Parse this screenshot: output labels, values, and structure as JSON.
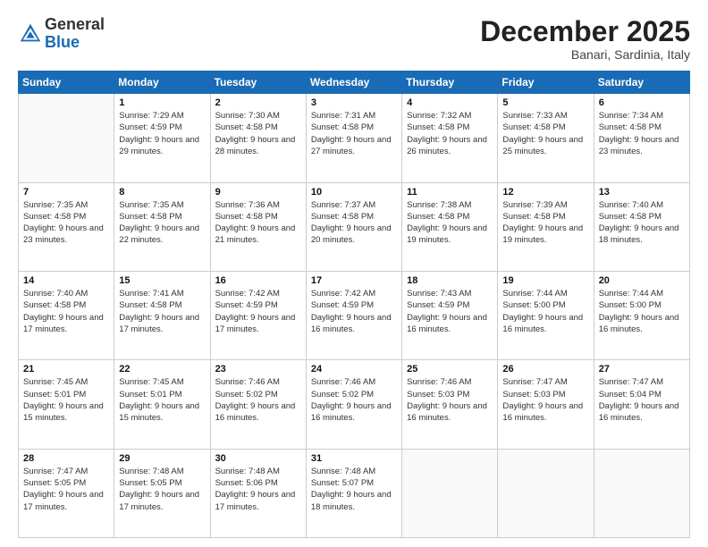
{
  "logo": {
    "general": "General",
    "blue": "Blue"
  },
  "header": {
    "month": "December 2025",
    "location": "Banari, Sardinia, Italy"
  },
  "days_of_week": [
    "Sunday",
    "Monday",
    "Tuesday",
    "Wednesday",
    "Thursday",
    "Friday",
    "Saturday"
  ],
  "weeks": [
    [
      {
        "num": "",
        "sunrise": "",
        "sunset": "",
        "daylight": ""
      },
      {
        "num": "1",
        "sunrise": "Sunrise: 7:29 AM",
        "sunset": "Sunset: 4:59 PM",
        "daylight": "Daylight: 9 hours and 29 minutes."
      },
      {
        "num": "2",
        "sunrise": "Sunrise: 7:30 AM",
        "sunset": "Sunset: 4:58 PM",
        "daylight": "Daylight: 9 hours and 28 minutes."
      },
      {
        "num": "3",
        "sunrise": "Sunrise: 7:31 AM",
        "sunset": "Sunset: 4:58 PM",
        "daylight": "Daylight: 9 hours and 27 minutes."
      },
      {
        "num": "4",
        "sunrise": "Sunrise: 7:32 AM",
        "sunset": "Sunset: 4:58 PM",
        "daylight": "Daylight: 9 hours and 26 minutes."
      },
      {
        "num": "5",
        "sunrise": "Sunrise: 7:33 AM",
        "sunset": "Sunset: 4:58 PM",
        "daylight": "Daylight: 9 hours and 25 minutes."
      },
      {
        "num": "6",
        "sunrise": "Sunrise: 7:34 AM",
        "sunset": "Sunset: 4:58 PM",
        "daylight": "Daylight: 9 hours and 23 minutes."
      }
    ],
    [
      {
        "num": "7",
        "sunrise": "Sunrise: 7:35 AM",
        "sunset": "Sunset: 4:58 PM",
        "daylight": "Daylight: 9 hours and 23 minutes."
      },
      {
        "num": "8",
        "sunrise": "Sunrise: 7:35 AM",
        "sunset": "Sunset: 4:58 PM",
        "daylight": "Daylight: 9 hours and 22 minutes."
      },
      {
        "num": "9",
        "sunrise": "Sunrise: 7:36 AM",
        "sunset": "Sunset: 4:58 PM",
        "daylight": "Daylight: 9 hours and 21 minutes."
      },
      {
        "num": "10",
        "sunrise": "Sunrise: 7:37 AM",
        "sunset": "Sunset: 4:58 PM",
        "daylight": "Daylight: 9 hours and 20 minutes."
      },
      {
        "num": "11",
        "sunrise": "Sunrise: 7:38 AM",
        "sunset": "Sunset: 4:58 PM",
        "daylight": "Daylight: 9 hours and 19 minutes."
      },
      {
        "num": "12",
        "sunrise": "Sunrise: 7:39 AM",
        "sunset": "Sunset: 4:58 PM",
        "daylight": "Daylight: 9 hours and 19 minutes."
      },
      {
        "num": "13",
        "sunrise": "Sunrise: 7:40 AM",
        "sunset": "Sunset: 4:58 PM",
        "daylight": "Daylight: 9 hours and 18 minutes."
      }
    ],
    [
      {
        "num": "14",
        "sunrise": "Sunrise: 7:40 AM",
        "sunset": "Sunset: 4:58 PM",
        "daylight": "Daylight: 9 hours and 17 minutes."
      },
      {
        "num": "15",
        "sunrise": "Sunrise: 7:41 AM",
        "sunset": "Sunset: 4:58 PM",
        "daylight": "Daylight: 9 hours and 17 minutes."
      },
      {
        "num": "16",
        "sunrise": "Sunrise: 7:42 AM",
        "sunset": "Sunset: 4:59 PM",
        "daylight": "Daylight: 9 hours and 17 minutes."
      },
      {
        "num": "17",
        "sunrise": "Sunrise: 7:42 AM",
        "sunset": "Sunset: 4:59 PM",
        "daylight": "Daylight: 9 hours and 16 minutes."
      },
      {
        "num": "18",
        "sunrise": "Sunrise: 7:43 AM",
        "sunset": "Sunset: 4:59 PM",
        "daylight": "Daylight: 9 hours and 16 minutes."
      },
      {
        "num": "19",
        "sunrise": "Sunrise: 7:44 AM",
        "sunset": "Sunset: 5:00 PM",
        "daylight": "Daylight: 9 hours and 16 minutes."
      },
      {
        "num": "20",
        "sunrise": "Sunrise: 7:44 AM",
        "sunset": "Sunset: 5:00 PM",
        "daylight": "Daylight: 9 hours and 16 minutes."
      }
    ],
    [
      {
        "num": "21",
        "sunrise": "Sunrise: 7:45 AM",
        "sunset": "Sunset: 5:01 PM",
        "daylight": "Daylight: 9 hours and 15 minutes."
      },
      {
        "num": "22",
        "sunrise": "Sunrise: 7:45 AM",
        "sunset": "Sunset: 5:01 PM",
        "daylight": "Daylight: 9 hours and 15 minutes."
      },
      {
        "num": "23",
        "sunrise": "Sunrise: 7:46 AM",
        "sunset": "Sunset: 5:02 PM",
        "daylight": "Daylight: 9 hours and 16 minutes."
      },
      {
        "num": "24",
        "sunrise": "Sunrise: 7:46 AM",
        "sunset": "Sunset: 5:02 PM",
        "daylight": "Daylight: 9 hours and 16 minutes."
      },
      {
        "num": "25",
        "sunrise": "Sunrise: 7:46 AM",
        "sunset": "Sunset: 5:03 PM",
        "daylight": "Daylight: 9 hours and 16 minutes."
      },
      {
        "num": "26",
        "sunrise": "Sunrise: 7:47 AM",
        "sunset": "Sunset: 5:03 PM",
        "daylight": "Daylight: 9 hours and 16 minutes."
      },
      {
        "num": "27",
        "sunrise": "Sunrise: 7:47 AM",
        "sunset": "Sunset: 5:04 PM",
        "daylight": "Daylight: 9 hours and 16 minutes."
      }
    ],
    [
      {
        "num": "28",
        "sunrise": "Sunrise: 7:47 AM",
        "sunset": "Sunset: 5:05 PM",
        "daylight": "Daylight: 9 hours and 17 minutes."
      },
      {
        "num": "29",
        "sunrise": "Sunrise: 7:48 AM",
        "sunset": "Sunset: 5:05 PM",
        "daylight": "Daylight: 9 hours and 17 minutes."
      },
      {
        "num": "30",
        "sunrise": "Sunrise: 7:48 AM",
        "sunset": "Sunset: 5:06 PM",
        "daylight": "Daylight: 9 hours and 17 minutes."
      },
      {
        "num": "31",
        "sunrise": "Sunrise: 7:48 AM",
        "sunset": "Sunset: 5:07 PM",
        "daylight": "Daylight: 9 hours and 18 minutes."
      },
      {
        "num": "",
        "sunrise": "",
        "sunset": "",
        "daylight": ""
      },
      {
        "num": "",
        "sunrise": "",
        "sunset": "",
        "daylight": ""
      },
      {
        "num": "",
        "sunrise": "",
        "sunset": "",
        "daylight": ""
      }
    ]
  ]
}
